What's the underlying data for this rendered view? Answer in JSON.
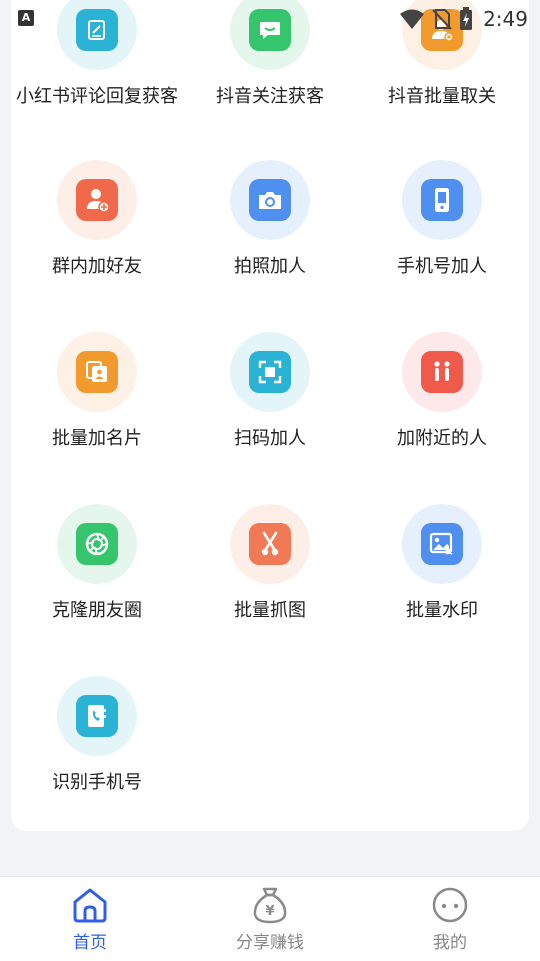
{
  "status_bar": {
    "time": "2:49",
    "notification_letter": "A"
  },
  "grid": {
    "tiles": [
      {
        "label": "小红书评论回复获客",
        "icon": "notebook-icon",
        "circle": "#e3f5f9",
        "square": "#2bb3d5"
      },
      {
        "label": "抖音关注获客",
        "icon": "chat-bubble-icon",
        "circle": "#e5f7ec",
        "square": "#34c56d"
      },
      {
        "label": "抖音批量取关",
        "icon": "user-remove-icon",
        "circle": "#fdf0e5",
        "square": "#f39a2e"
      },
      {
        "label": "群内加好友",
        "icon": "add-contact-icon",
        "circle": "#fdeee8",
        "square": "#f0694a"
      },
      {
        "label": "拍照加人",
        "icon": "camera-icon",
        "circle": "#e6f0fd",
        "square": "#4f8ff0"
      },
      {
        "label": "手机号加人",
        "icon": "phone-icon",
        "circle": "#e6f0fd",
        "square": "#4f8ff0"
      },
      {
        "label": "批量加名片",
        "icon": "business-card-icon",
        "circle": "#fdf0e5",
        "square": "#f39a2e"
      },
      {
        "label": "扫码加人",
        "icon": "scan-icon",
        "circle": "#e3f5f9",
        "square": "#2bb3d5"
      },
      {
        "label": "加附近的人",
        "icon": "nearby-people-icon",
        "circle": "#fde9e9",
        "square": "#f05a4b"
      },
      {
        "label": "克隆朋友圈",
        "icon": "aperture-icon",
        "circle": "#e5f7ec",
        "square": "#34c56d"
      },
      {
        "label": "批量抓图",
        "icon": "scissors-icon",
        "circle": "#fdeee8",
        "square": "#f07a55"
      },
      {
        "label": "批量水印",
        "icon": "image-icon",
        "circle": "#e6f0fd",
        "square": "#4f8ff0"
      },
      {
        "label": "识别手机号",
        "icon": "contact-book-icon",
        "circle": "#e3f5f9",
        "square": "#2bb3d5"
      }
    ]
  },
  "bottom_nav": {
    "items": [
      {
        "label": "首页",
        "icon": "home-icon",
        "active": true
      },
      {
        "label": "分享赚钱",
        "icon": "money-bag-icon",
        "active": false
      },
      {
        "label": "我的",
        "icon": "profile-face-icon",
        "active": false
      }
    ]
  },
  "colors": {
    "accent": "#2f5fe8",
    "inactive": "#888888",
    "page_bg": "#f2f3f5",
    "card_bg": "#ffffff"
  }
}
